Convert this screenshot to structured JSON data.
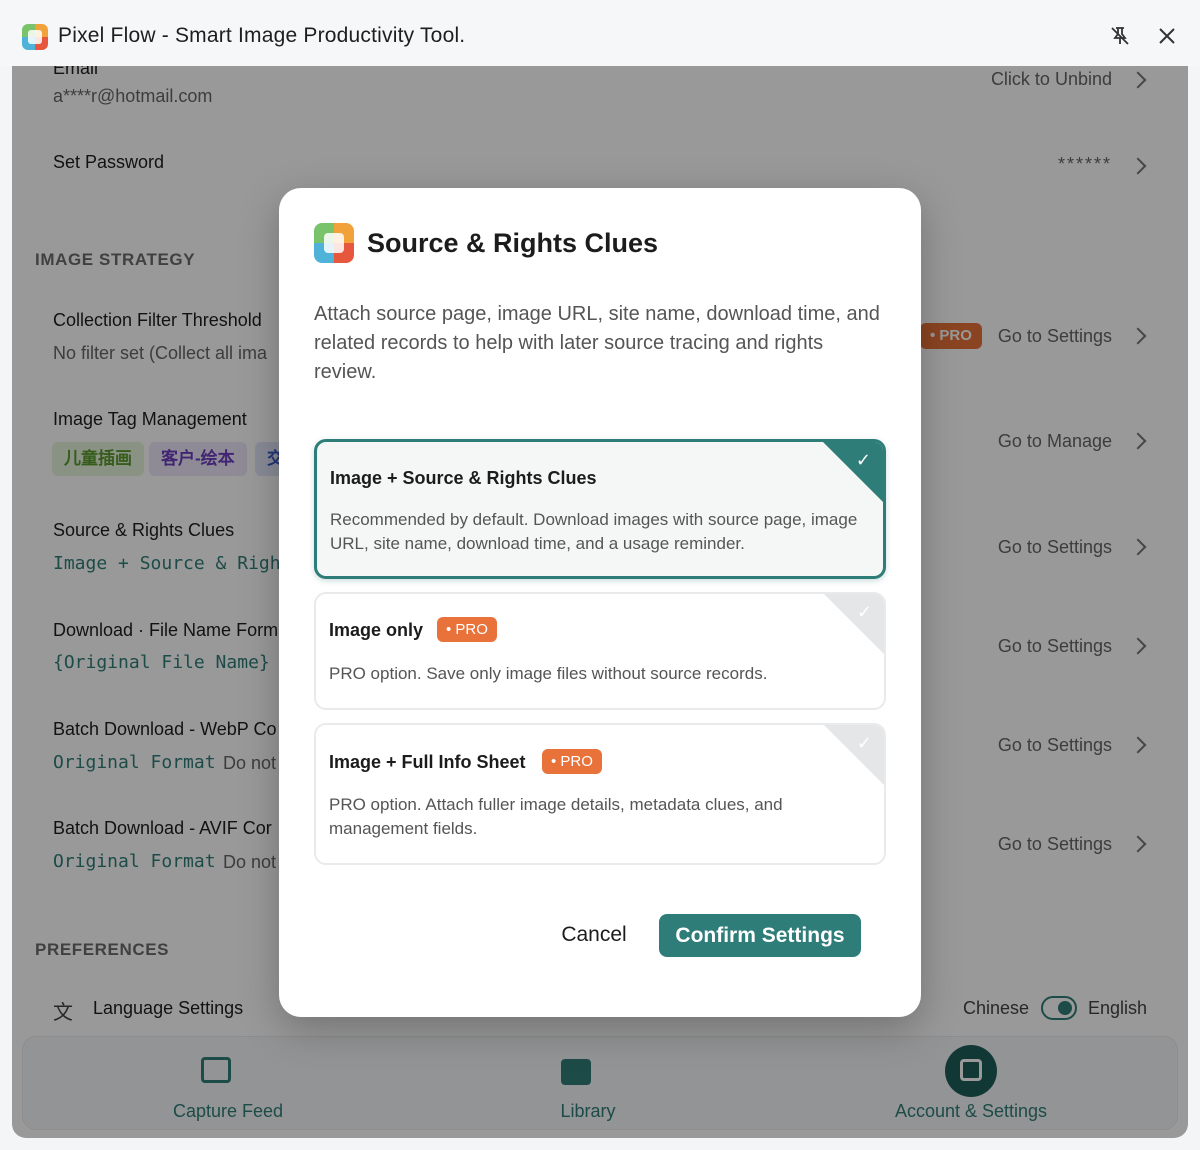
{
  "window": {
    "title": "Pixel Flow - Smart Image Productivity Tool.",
    "pin_icon": "pin-off-icon",
    "close_icon": "close-icon"
  },
  "account": {
    "email_label": "Email",
    "email_value": "a****r@hotmail.com",
    "email_action": "Click to Unbind",
    "password_label": "Set Password",
    "password_value": "******"
  },
  "sections": {
    "image_strategy": "IMAGE STRATEGY",
    "preferences": "PREFERENCES"
  },
  "settings": {
    "collection_filter": {
      "label": "Collection Filter Threshold",
      "sub": "No filter set (Collect all ima",
      "pro": "• PRO",
      "action": "Go to Settings"
    },
    "tag_management": {
      "label": "Image Tag Management",
      "tags": [
        "儿童插画",
        "客户-绘本",
        "交"
      ],
      "action": "Go to Manage"
    },
    "source_rights": {
      "label": "Source & Rights Clues",
      "sub": "Image + Source & Right",
      "action": "Go to Settings"
    },
    "file_name_format": {
      "label": "Download · File Name Form",
      "sub": "{Original File Name} |",
      "action": "Go to Settings"
    },
    "webp": {
      "label": "Batch Download - WebP Co",
      "sub_mono": "Original Format",
      "sub": "Do not",
      "action": "Go to Settings"
    },
    "avif": {
      "label": "Batch Download - AVIF Cor",
      "sub_mono": "Original Format",
      "sub": "Do not",
      "action": "Go to Settings"
    },
    "language": {
      "label": "Language Settings",
      "left": "Chinese",
      "right": "English"
    }
  },
  "nav": {
    "items": [
      {
        "label": "Capture Feed",
        "icon": "image-icon"
      },
      {
        "label": "Library",
        "icon": "library-icon"
      },
      {
        "label": "Account & Settings",
        "icon": "account-settings-icon"
      }
    ],
    "active": "Account & Settings"
  },
  "modal": {
    "title": "Source & Rights Clues",
    "description": "Attach source page, image URL, site name, download time, and related records to help with later source tracing and rights review.",
    "options": [
      {
        "title": "Image + Source & Rights Clues",
        "desc": "Recommended by default. Download images with source page, image URL, site name, download time, and a usage reminder.",
        "selected": true,
        "pro": ""
      },
      {
        "title": "Image only",
        "desc": "PRO option. Save only image files without source records.",
        "selected": false,
        "pro": "• PRO"
      },
      {
        "title": "Image + Full Info Sheet",
        "desc": "PRO option. Attach fuller image details, metadata clues, and management fields.",
        "selected": false,
        "pro": "• PRO"
      }
    ],
    "cancel": "Cancel",
    "confirm": "Confirm Settings"
  },
  "colors": {
    "accent": "#2f7d78",
    "pro": "#e8723a",
    "tag1_bg": "#e7f3dc",
    "tag1_fg": "#5a9a2e",
    "tag2_bg": "#ede6fb",
    "tag2_fg": "#6f3fbf"
  }
}
